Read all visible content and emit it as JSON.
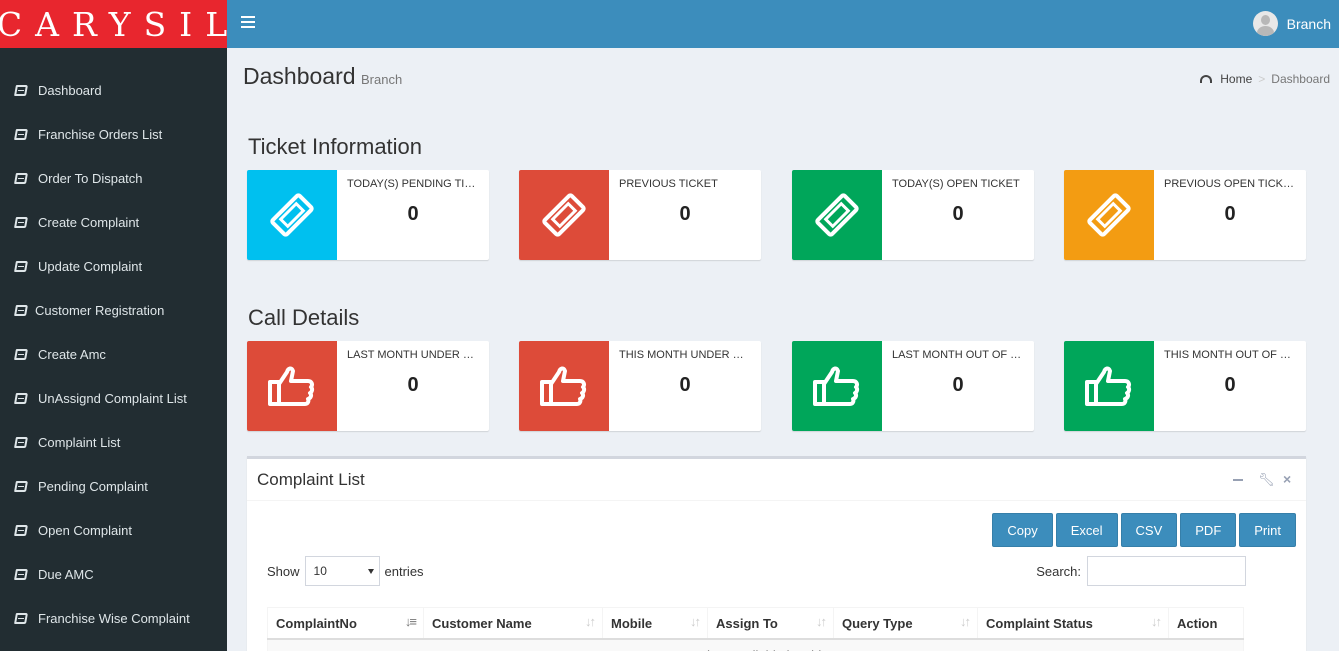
{
  "brand": {
    "logo_text": "CARYSIL",
    "logo_color": "#e8262e",
    "header_color": "#3c8dbc"
  },
  "header": {
    "menu_icon": "bars-icon",
    "user_name": "Branch"
  },
  "sidebar": {
    "items": [
      {
        "label": "Dashboard"
      },
      {
        "label": "Franchise Orders List"
      },
      {
        "label": "Order To Dispatch"
      },
      {
        "label": "Create Complaint"
      },
      {
        "label": "Update Complaint"
      },
      {
        "label": "Customer Registration"
      },
      {
        "label": "Create Amc"
      },
      {
        "label": "UnAssignd Complaint List"
      },
      {
        "label": "Complaint List"
      },
      {
        "label": "Pending Complaint"
      },
      {
        "label": "Open Complaint"
      },
      {
        "label": "Due AMC"
      },
      {
        "label": "Franchise Wise Complaint"
      }
    ]
  },
  "page": {
    "title": "Dashboard",
    "subtitle": "Branch",
    "breadcrumb": {
      "home": "Home",
      "current": "Dashboard"
    }
  },
  "ticket_info": {
    "title": "Ticket Information",
    "boxes": [
      {
        "label": "TODAY(S) PENDING TICKET",
        "value": "0",
        "color": "#00c0ef",
        "icon": "ticket-icon"
      },
      {
        "label": "PREVIOUS TICKET",
        "value": "0",
        "color": "#dd4b39",
        "icon": "ticket-icon"
      },
      {
        "label": "TODAY(S) OPEN TICKET",
        "value": "0",
        "color": "#00a65a",
        "icon": "ticket-icon"
      },
      {
        "label": "PREVIOUS OPEN TICKET",
        "value": "0",
        "color": "#f39c12",
        "icon": "ticket-icon"
      }
    ]
  },
  "call_details": {
    "title": "Call Details",
    "boxes": [
      {
        "label": "LAST MONTH UNDER WARRANTY",
        "value": "0",
        "color": "#dd4b39",
        "icon": "thumbs-up-icon"
      },
      {
        "label": "THIS MONTH UNDER WARRANTY",
        "value": "0",
        "color": "#dd4b39",
        "icon": "thumbs-up-icon"
      },
      {
        "label": "LAST MONTH OUT OF WARRANTY",
        "value": "0",
        "color": "#00a65a",
        "icon": "thumbs-up-icon"
      },
      {
        "label": "THIS MONTH OUT OF WARRANTY",
        "value": "0",
        "color": "#00a65a",
        "icon": "thumbs-up-icon"
      }
    ]
  },
  "complaint_list": {
    "title": "Complaint List",
    "buttons": {
      "copy": "Copy",
      "excel": "Excel",
      "csv": "CSV",
      "pdf": "PDF",
      "print": "Print"
    },
    "show_label": "Show",
    "page_length": "10",
    "entries_label": "entries",
    "search_label": "Search:",
    "columns": [
      "ComplaintNo",
      "Customer Name",
      "Mobile",
      "Assign To",
      "Query Type",
      "Complaint Status",
      "Action"
    ],
    "empty_message": "No data available in table"
  }
}
